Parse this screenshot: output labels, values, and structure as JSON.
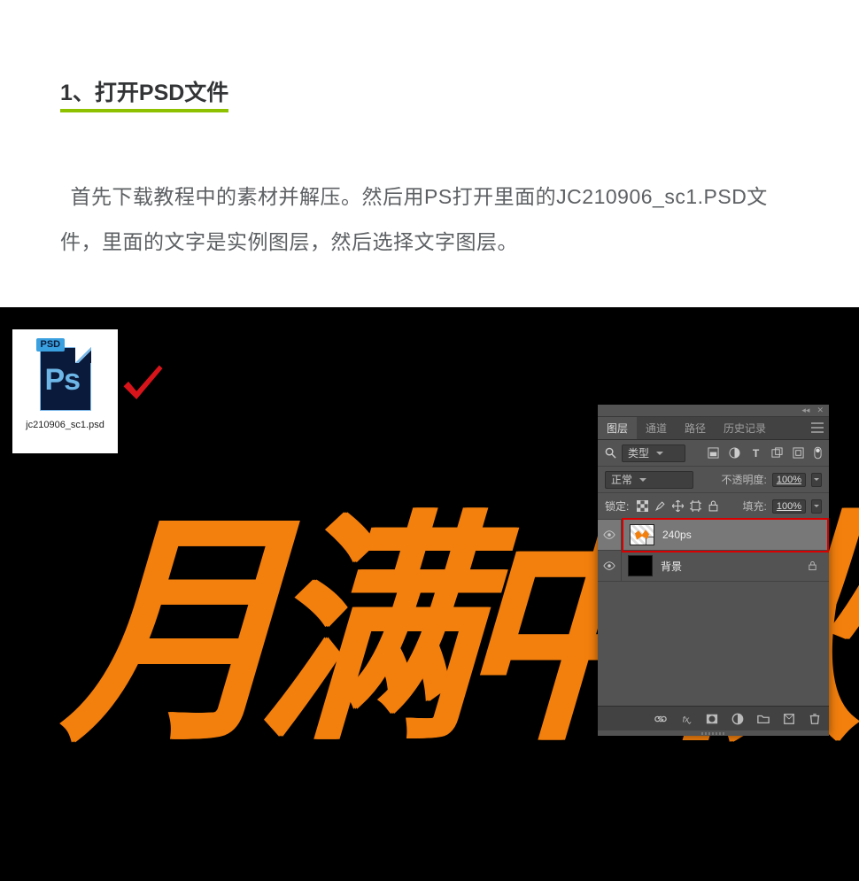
{
  "step": {
    "heading": "1、打开PSD文件",
    "body": "首先下载教程中的素材并解压。然后用PS打开里面的JC210906_sc1.PSD文件，里面的文字是实例图层，然后选择文字图层。"
  },
  "psd_file": {
    "badge": "PSD",
    "logo": "Ps",
    "filename": "jc210906_sc1.psd"
  },
  "canvas_text": "月满中秋",
  "layers_panel": {
    "tabs": [
      "图层",
      "通道",
      "路径",
      "历史记录"
    ],
    "active_tab": 0,
    "filter_label": "类型",
    "blend_mode": "正常",
    "opacity_label": "不透明度:",
    "opacity_value": "100%",
    "lock_label": "锁定:",
    "fill_label": "填充:",
    "fill_value": "100%",
    "layers": [
      {
        "name": "240ps",
        "selected": true,
        "visible": true,
        "smart": true
      },
      {
        "name": "背景",
        "selected": false,
        "visible": true,
        "locked": true,
        "bg": true
      }
    ]
  }
}
